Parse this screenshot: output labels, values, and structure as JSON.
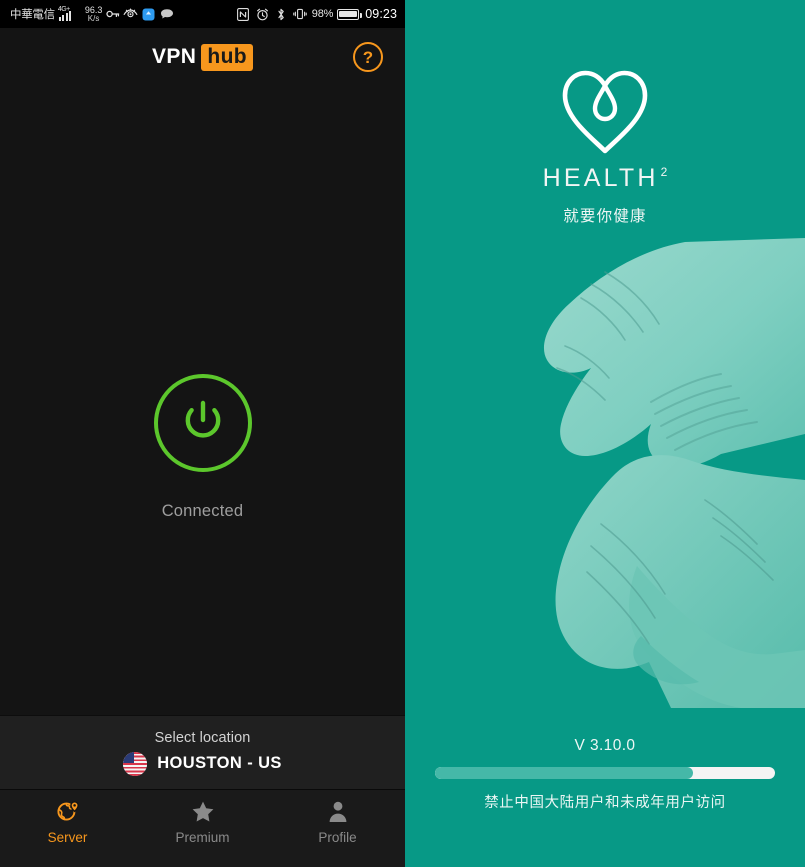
{
  "statusbar": {
    "carrier": "中華電信",
    "network_type": "4G+",
    "speed_value": "96.3",
    "speed_unit": "K/s",
    "icons_left": [
      "vpn-key-icon",
      "eye-care-icon",
      "app-blue-icon",
      "message-icon"
    ],
    "icons_right": [
      "nfc-icon",
      "alarm-icon",
      "bluetooth-icon",
      "vibrate-icon"
    ],
    "battery_percent": "98%",
    "battery_level": 98,
    "time": "09:23"
  },
  "vpn_app": {
    "logo_primary": "VPN",
    "logo_accent": "hub",
    "help_label": "?",
    "connection_status": "Connected",
    "power_icon": "power-icon",
    "location": {
      "title": "Select location",
      "name": "HOUSTON - US",
      "flag": "us-flag-icon"
    },
    "nav": [
      {
        "label": "Server",
        "icon": "globe-pin-icon",
        "active": true
      },
      {
        "label": "Premium",
        "icon": "star-icon",
        "active": false
      },
      {
        "label": "Profile",
        "icon": "person-icon",
        "active": false
      }
    ],
    "colors": {
      "accent": "#f7971d",
      "connected": "#5cc72c",
      "background": "#141414",
      "panel": "#202020",
      "nav_background": "#1a1a1a"
    }
  },
  "health_app": {
    "logo_icon": "heart-droplet-icon",
    "brand_name": "HEALTH",
    "brand_superscript": "2",
    "tagline": "就要你健康",
    "illustration": "gloved-hands-icon",
    "version": "V 3.10.0",
    "progress_percent": 76,
    "notice": "禁止中国大陆用户和未成年用户访问",
    "colors": {
      "background": "#079986",
      "progress_fill": "#45b8a8",
      "progress_track": "#f4f4f4",
      "text": "#eef6f4"
    }
  }
}
